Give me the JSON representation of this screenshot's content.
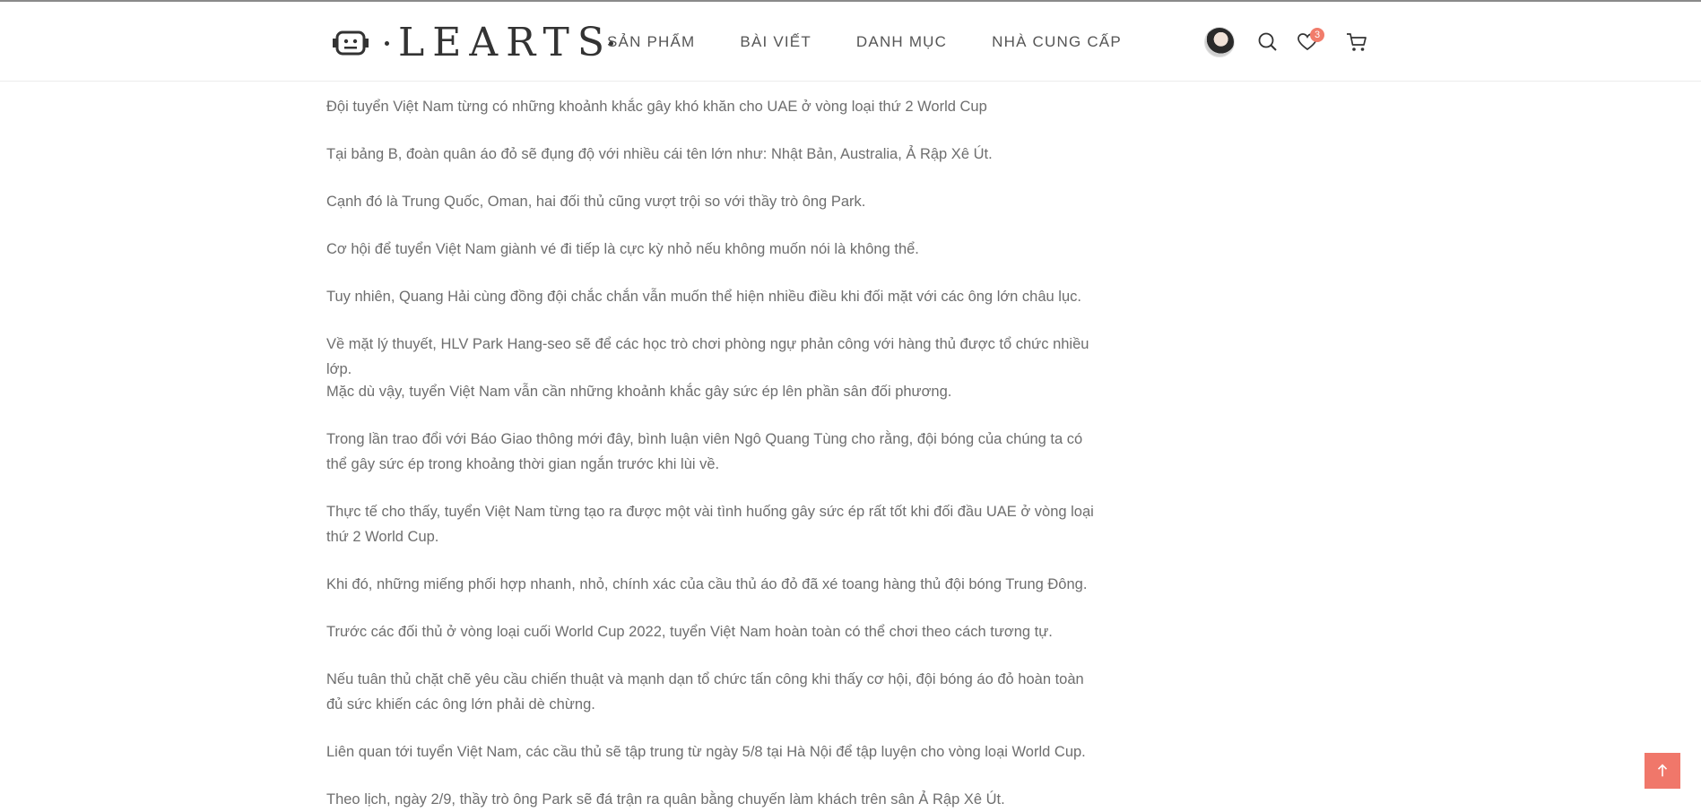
{
  "header": {
    "logo_text": "LEARTS",
    "nav": [
      "SẢN PHẨM",
      "BÀI VIẾT",
      "DANH MỤC",
      "NHÀ CUNG CẤP"
    ],
    "wishlist_count": "3",
    "icons": [
      "user-avatar",
      "search-icon",
      "heart-icon",
      "cart-icon"
    ]
  },
  "article": {
    "paragraphs": [
      "Đội tuyển Việt Nam từng có những khoảnh khắc gây khó khăn cho UAE ở vòng loại thứ 2 World Cup",
      "Tại bảng B, đoàn quân áo đỏ sẽ đụng độ với nhiều cái tên lớn như: Nhật Bản, Australia, Ả Rập Xê Út.",
      "Cạnh đó là Trung Quốc, Oman, hai đối thủ cũng vượt trội so với thầy trò ông Park.",
      "Cơ hội để tuyển Việt Nam giành vé đi tiếp là cực kỳ nhỏ nếu không muốn nói là không thể.",
      "Tuy nhiên, Quang Hải cùng đồng đội chắc chắn vẫn muốn thể hiện nhiều điều khi đối mặt với các ông lớn châu lục.",
      "Về mặt lý thuyết, HLV Park Hang-seo sẽ để các học trò chơi phòng ngự phản công với hàng thủ được tổ chức nhiều lớp.",
      "Mặc dù vậy, tuyển Việt Nam vẫn cần những khoảnh khắc gây sức ép lên phần sân đối phương.",
      "Trong lần trao đổi với Báo Giao thông mới đây, bình luận viên Ngô Quang Tùng cho rằng, đội bóng của chúng ta có thể gây sức ép trong khoảng thời gian ngắn trước khi lùi về.",
      "Thực tế cho thấy, tuyển Việt Nam từng tạo ra được một vài tình huống gây sức ép rất tốt khi đối đầu UAE ở vòng loại thứ 2 World Cup.",
      "Khi đó, những miếng phối hợp nhanh, nhỏ, chính xác của cầu thủ áo đỏ đã xé toang hàng thủ đội bóng Trung Đông.",
      "Trước các đối thủ ở vòng loại cuối World Cup 2022, tuyển Việt Nam hoàn toàn có thể chơi theo cách tương tự.",
      "Nếu tuân thủ chặt chẽ yêu cầu chiến thuật và mạnh dạn tổ chức tấn công khi thấy cơ hội, đội bóng áo đỏ hoàn toàn đủ sức khiến các ông lớn phải dè chừng.",
      "Liên quan tới tuyển Việt Nam, các cầu thủ sẽ tập trung từ ngày 5/8 tại Hà Nội để tập luyện cho vòng loại World Cup.",
      "Theo lịch, ngày 2/9, thầy trò ông Park sẽ đá trận ra quân bằng chuyến làm khách trên sân Ả Rập Xê Út."
    ]
  },
  "colors": {
    "accent": "#f0776a",
    "text": "#6e6e6e"
  }
}
